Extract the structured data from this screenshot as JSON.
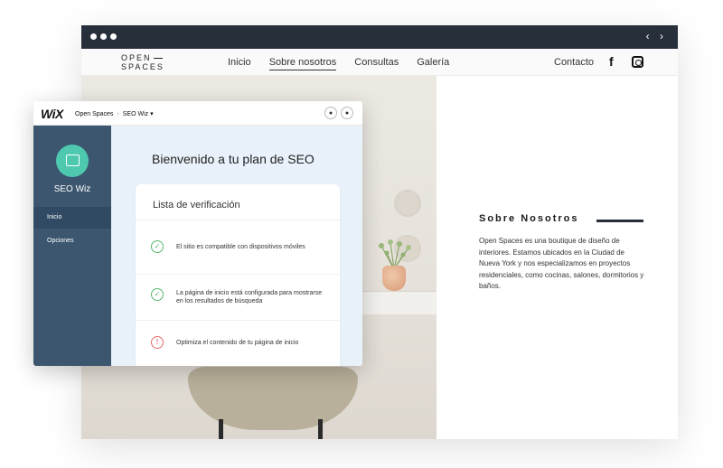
{
  "browser": {
    "nav_arrows": "‹ ›"
  },
  "site": {
    "logo_line1": "OPEN",
    "logo_line2": "SPACES",
    "menu": [
      "Inicio",
      "Sobre nosotros",
      "Consultas",
      "Galería"
    ],
    "active_menu": "Sobre nosotros",
    "contact": "Contacto",
    "facebook_icon": "f"
  },
  "about": {
    "title": "Sobre Nosotros",
    "text": "Open Spaces es una boutique de diseño de interiores. Estamos ubicados en la Ciudad de Nueva York y nos especializamos en proyectos residenciales, como cocinas, salones, dormitorios y baños."
  },
  "wix": {
    "logo": "WiX",
    "crumb_site": "Open Spaces",
    "crumb_app": "SEO Wiz ▾",
    "app_name": "SEO Wiz",
    "sidebar": [
      "Inicio",
      "Opciones"
    ],
    "heading": "Bienvenido a tu plan de SEO",
    "checklist_title": "Lista de verificación",
    "items": [
      {
        "text": "El sitio es compatible con dispositivos móviles",
        "status": "done"
      },
      {
        "text": "La página de inicio está configurada para mostrarse en los resultados de búsqueda",
        "status": "done"
      },
      {
        "text": "Optimiza el contenido de tu página de inicio",
        "status": "warning"
      }
    ],
    "colors": {
      "sidebar": "#3c5670",
      "accent": "#4ec9b0",
      "check": "#5ab96b",
      "warning": "#e86c6c"
    }
  }
}
